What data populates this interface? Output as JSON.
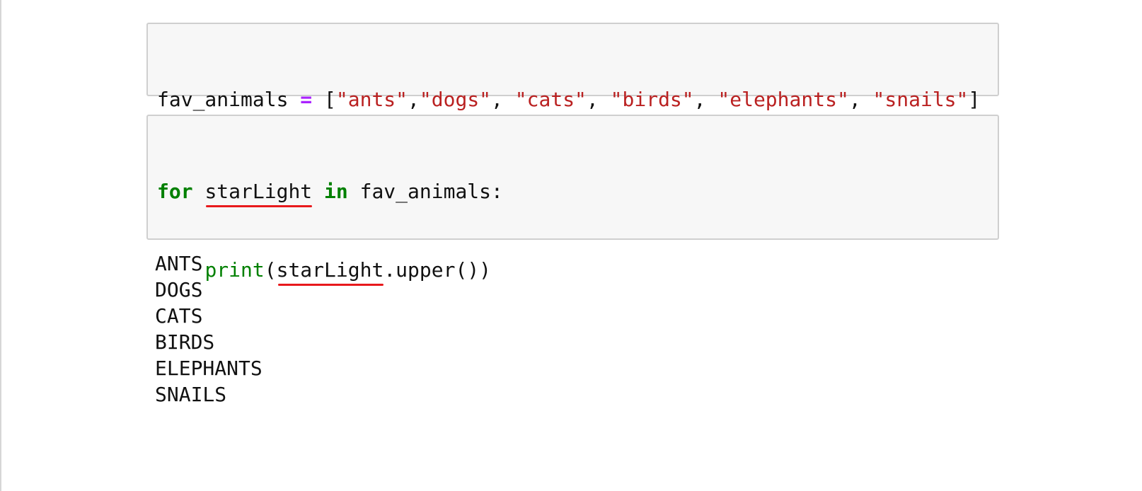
{
  "cell1": {
    "tokens": {
      "t1": "fav_animals ",
      "t2": "=",
      "t3": " [",
      "t4": "\"ants\"",
      "t5": ",",
      "t6": "\"dogs\"",
      "t7": ", ",
      "t8": "\"cats\"",
      "t9": ", ",
      "t10": "\"birds\"",
      "t11": ", ",
      "t12": "\"elephants\"",
      "t13": ", ",
      "t14": "\"snails\"",
      "t15": "]"
    }
  },
  "cell2": {
    "line1": {
      "kw_for": "for",
      "sp1": " ",
      "var": "starLight",
      "sp2": " ",
      "kw_in": "in",
      "rest": " fav_animals:"
    },
    "line2": {
      "indent": "    ",
      "func": "print",
      "open": "(",
      "var": "starLight",
      "rest": ".upper())"
    }
  },
  "output": {
    "lines": [
      "ANTS",
      "DOGS",
      "CATS",
      "BIRDS",
      "ELEPHANTS",
      "SNAILS"
    ]
  },
  "colors": {
    "keyword": "#008000",
    "operator": "#aa22ff",
    "string": "#ba2121",
    "squiggle": "#e8191c",
    "cell_background": "#f7f7f7",
    "cell_border": "#cfcfcf"
  }
}
